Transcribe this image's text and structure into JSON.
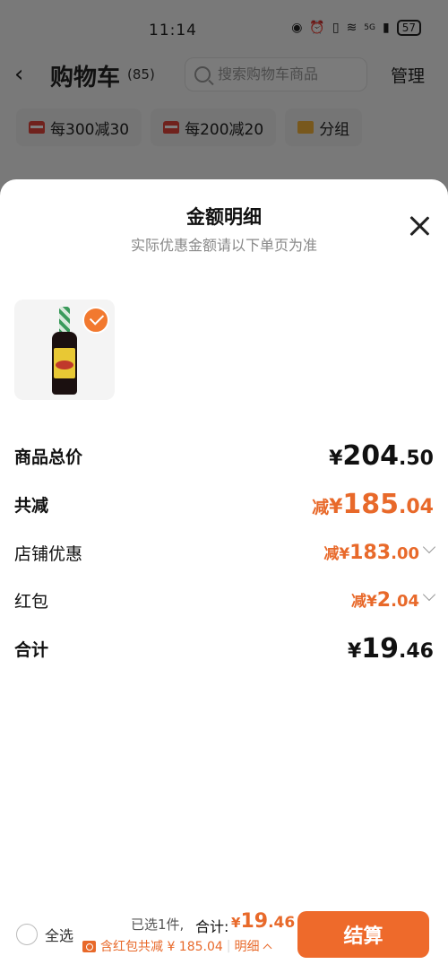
{
  "status_bar": {
    "time": "11:14",
    "network": "5G",
    "battery": "57"
  },
  "nav": {
    "title": "购物车",
    "count": "(85)",
    "search_placeholder": "搜索购物车商品",
    "manage_label": "管理"
  },
  "chips": [
    {
      "label": "每300减30",
      "icon": "coupon-icon"
    },
    {
      "label": "每200减20",
      "icon": "coupon-icon"
    },
    {
      "label": "分组",
      "icon": "folder-icon"
    }
  ],
  "sheet": {
    "title": "金额明细",
    "subtitle": "实际优惠金额请以下单页为准",
    "rows": {
      "total_price": {
        "label": "商品总价",
        "currency": "¥",
        "int": "204",
        "dec": ".50"
      },
      "total_reduce": {
        "label": "共减",
        "prefix": "减",
        "currency": "¥",
        "int": "185",
        "dec": ".04"
      },
      "store_discount": {
        "label": "店铺优惠",
        "prefix": "减",
        "currency": "¥",
        "int": "183",
        "dec": ".00"
      },
      "red_packet": {
        "label": "红包",
        "prefix": "减",
        "currency": "¥",
        "int": "2",
        "dec": ".04"
      },
      "sum": {
        "label": "合计",
        "currency": "¥",
        "int": "19",
        "dec": ".46"
      }
    }
  },
  "bottom_bar": {
    "select_all_label": "全选",
    "selected_info": "已选1件,",
    "total_label": "合计:",
    "total_currency": "¥",
    "total_int": "19",
    "total_dec": ".46",
    "coupon_text": "含红包共减 ¥ 185.04",
    "detail_label": "明细",
    "checkout_label": "结算"
  },
  "colors": {
    "accent": "#e8692a",
    "button": "#ee6a2b"
  }
}
